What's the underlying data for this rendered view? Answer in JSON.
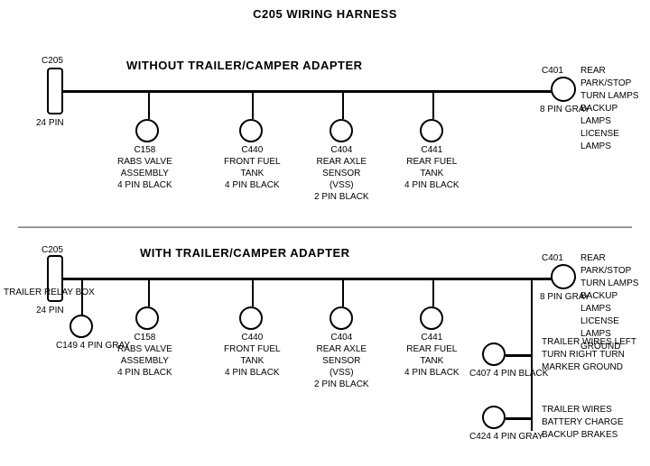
{
  "title": "C205 WIRING HARNESS",
  "section1": {
    "label": "WITHOUT  TRAILER/CAMPER  ADAPTER",
    "left_connector": "C205",
    "left_pin": "24 PIN",
    "right_connector": "C401",
    "right_pin": "8 PIN\nGRAY",
    "right_label": "REAR PARK/STOP\nTURN LAMPS\nBACKUP LAMPS\nLICENSE LAMPS",
    "connectors": [
      {
        "id": "C158",
        "label": "C158\nRABS VALVE\nASSEMBLY\n4 PIN BLACK"
      },
      {
        "id": "C440",
        "label": "C440\nFRONT FUEL\nTANK\n4 PIN BLACK"
      },
      {
        "id": "C404",
        "label": "C404\nREAR AXLE\nSENSOR\n(VSS)\n2 PIN BLACK"
      },
      {
        "id": "C441",
        "label": "C441\nREAR FUEL\nTANK\n4 PIN BLACK"
      }
    ]
  },
  "section2": {
    "label": "WITH  TRAILER/CAMPER  ADAPTER",
    "left_connector": "C205",
    "left_pin": "24 PIN",
    "right_connector": "C401",
    "right_pin": "8 PIN\nGRAY",
    "right_label": "REAR PARK/STOP\nTURN LAMPS\nBACKUP LAMPS\nLICENSE LAMPS\nGROUND",
    "trailer_relay": "TRAILER\nRELAY\nBOX",
    "c149": "C149\n4 PIN GRAY",
    "connectors": [
      {
        "id": "C158",
        "label": "C158\nRABS VALVE\nASSEMBLY\n4 PIN BLACK"
      },
      {
        "id": "C440",
        "label": "C440\nFRONT FUEL\nTANK\n4 PIN BLACK"
      },
      {
        "id": "C404",
        "label": "C404\nREAR AXLE\nSENSOR\n(VSS)\n2 PIN BLACK"
      },
      {
        "id": "C441",
        "label": "C441\nREAR FUEL\nTANK\n4 PIN BLACK"
      }
    ],
    "c407_label": "C407\n4 PIN\nBLACK",
    "c407_wires": "TRAILER WIRES\nLEFT TURN\nRIGHT TURN\nMARKER\nGROUND",
    "c424_label": "C424\n4 PIN\nGRAY",
    "c424_wires": "TRAILER WIRES\nBATTERY CHARGE\nBACKUP\nBRAKES"
  }
}
